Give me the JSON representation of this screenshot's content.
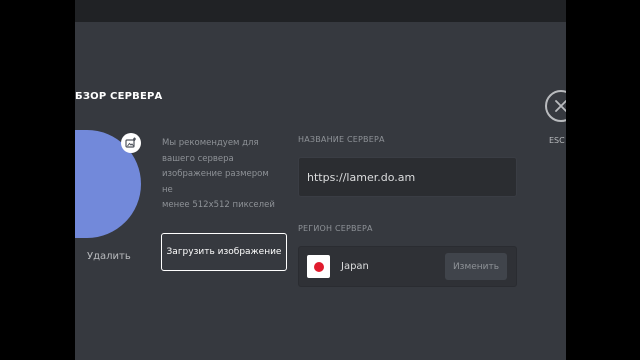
{
  "header": {
    "section_title": "БЗОР СЕРВЕРА"
  },
  "close": {
    "label": "ESC",
    "icon": "close-icon"
  },
  "avatar": {
    "color": "#7289da",
    "upload_icon": "image-upload-icon",
    "remove_label": "Удалить"
  },
  "hint": {
    "lines": [
      "Мы рекомендуем для",
      "вашего сервера",
      "изображение размером не",
      "менее 512x512 пикселей"
    ]
  },
  "upload_button_label": "Загрузить изображение",
  "server_name": {
    "label": "НАЗВАНИЕ СЕРВЕРА",
    "value": "https://lamer.do.am"
  },
  "region": {
    "label": "РЕГИОН СЕРВЕРА",
    "name": "Japan",
    "flag_icon": "japan-flag-icon",
    "change_label": "Изменить"
  }
}
